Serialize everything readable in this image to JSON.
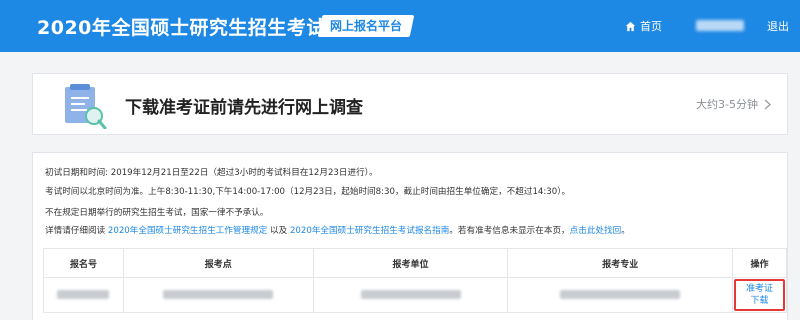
{
  "header": {
    "title": "2020年全国硕士研究生招生考试",
    "platform": "网上报名平台",
    "home": "首页",
    "logout": "退出"
  },
  "survey": {
    "title": "下载准考证前请先进行网上调查",
    "duration": "大约3-5分钟"
  },
  "info": {
    "line1": "初试日期和时间: 2019年12月21日至22日（超过3小时的考试科目在12月23日进行）。",
    "line2": "考试时间以北京时间为准。上午8:30-11:30,下午14:00-17:00（12月23日，起始时间8:30，截止时间由招生单位确定，不超过14:30）。",
    "line3": "不在规定日期举行的研究生招生考试，国家一律不予承认。",
    "line4_prefix": "详情请仔细阅读",
    "link1": "2020年全国硕士研究生招生工作管理规定",
    "and": "以及",
    "link2": "2020年全国硕士研究生招生考试报名指南",
    "line4_mid": "。若有准考信息未显示在本页，",
    "link3": "点击此处找回",
    "line4_end": "。"
  },
  "table": {
    "headers": [
      "报名号",
      "报考点",
      "报考单位",
      "报考专业",
      "操作"
    ],
    "download": "准考证下载"
  },
  "colors": {
    "brand": "#1e88e5",
    "highlight_border": "#e53935"
  },
  "icons": {
    "home": "home-icon",
    "survey": "clipboard-check-icon",
    "arrow": "chevron-right-icon"
  }
}
